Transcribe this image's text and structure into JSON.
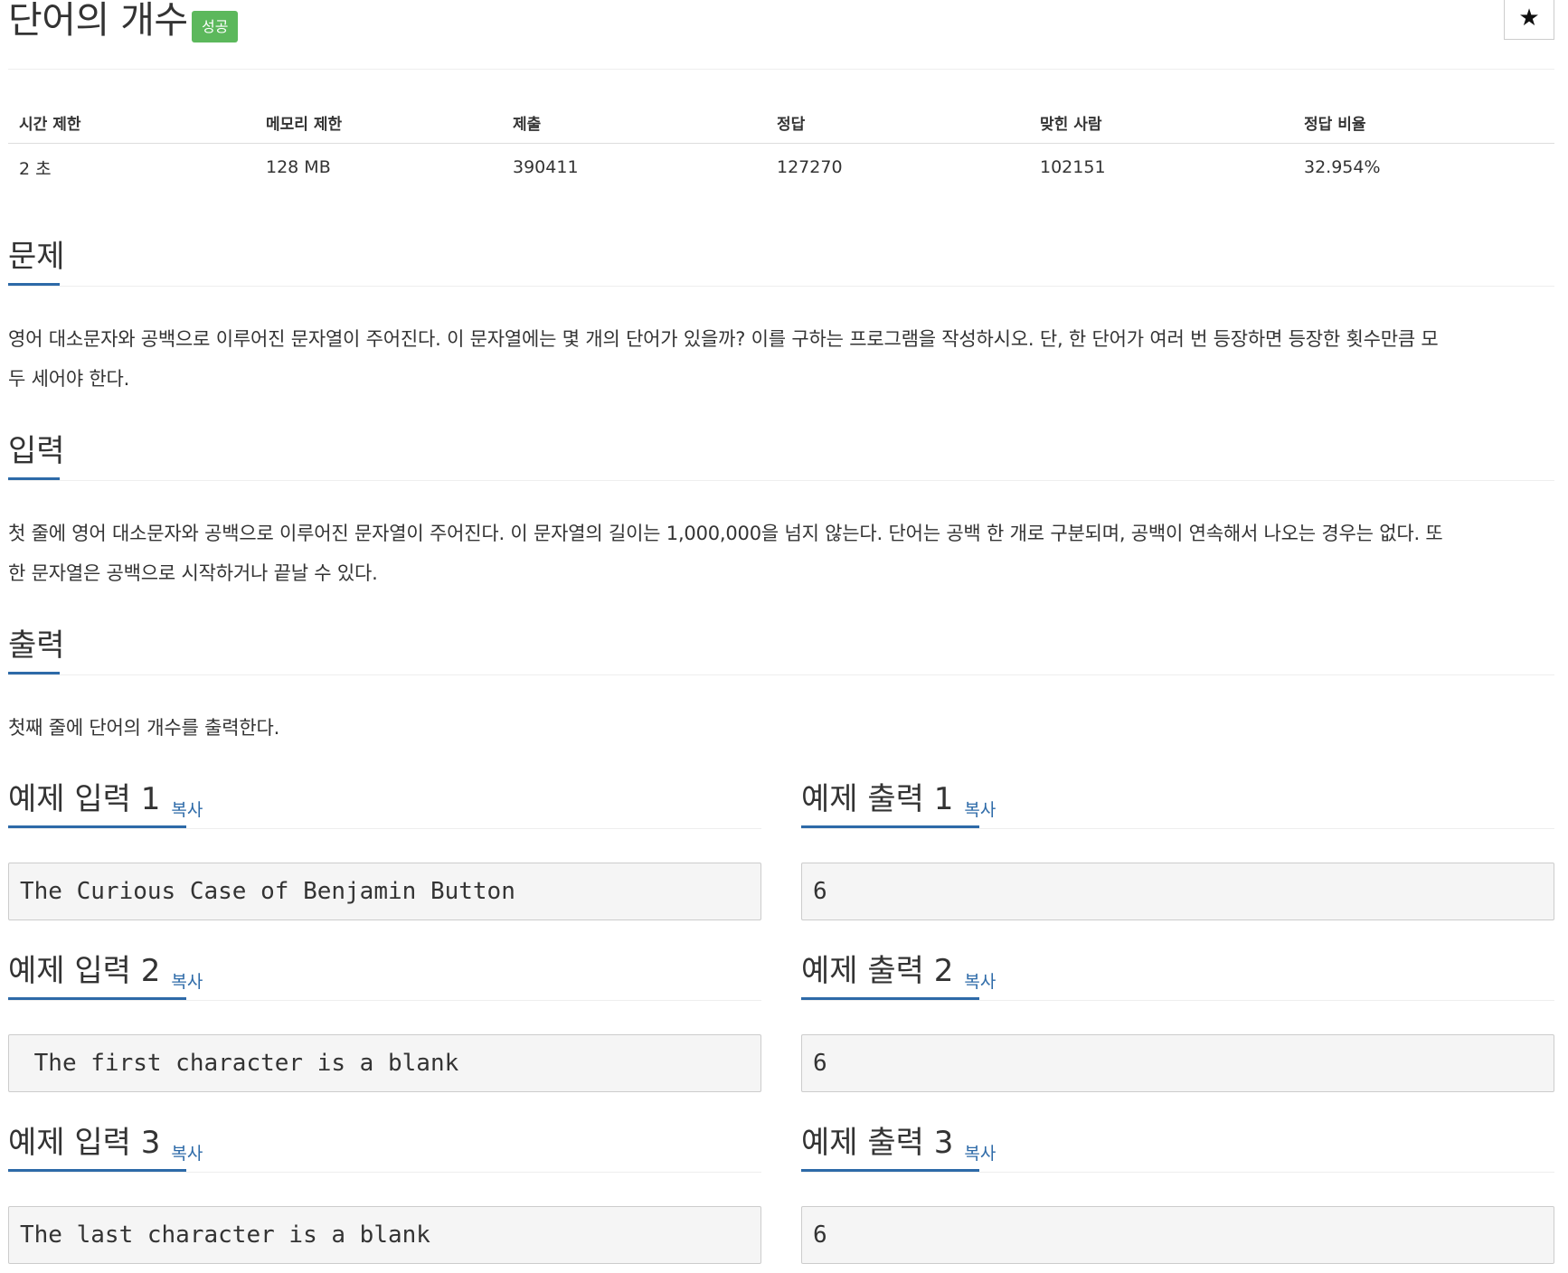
{
  "problem": {
    "title": "단어의 개수",
    "badge": "성공",
    "star": "★"
  },
  "info_table": {
    "headers": [
      "시간 제한",
      "메모리 제한",
      "제출",
      "정답",
      "맞힌 사람",
      "정답 비율"
    ],
    "values": [
      "2 초",
      "128 MB",
      "390411",
      "127270",
      "102151",
      "32.954%"
    ]
  },
  "sections": {
    "description": {
      "title": "문제",
      "lines": [
        "영어 대소문자와 공백으로 이루어진 문자열이 주어진다. 이 문자열에는 몇 개의 단어가 있을까? 이를 구하는 프로그램을 작성하시오. 단, 한 단어가 여러 번 등장하면 등장한 횟수만큼 모",
        "두 세어야 한다."
      ]
    },
    "input": {
      "title": "입력",
      "lines": [
        "첫 줄에 영어 대소문자와 공백으로 이루어진 문자열이 주어진다. 이 문자열의 길이는 1,000,000을 넘지 않는다. 단어는 공백 한 개로 구분되며, 공백이 연속해서 나오는 경우는 없다. 또",
        "한 문자열은 공백으로 시작하거나 끝날 수 있다."
      ]
    },
    "output": {
      "title": "출력",
      "lines": [
        "첫째 줄에 단어의 개수를 출력한다."
      ]
    }
  },
  "samples": {
    "copy_label": "복사",
    "items": [
      {
        "input_title": "예제 입력 1",
        "input": "The Curious Case of Benjamin Button",
        "output_title": "예제 출력 1",
        "output": "6"
      },
      {
        "input_title": "예제 입력 2",
        "input": " The first character is a blank",
        "output_title": "예제 출력 2",
        "output": "6"
      },
      {
        "input_title": "예제 입력 3",
        "input": "The last character is a blank",
        "output_title": "예제 출력 3",
        "output": "6"
      }
    ]
  },
  "colors": {
    "accent": "#2d6aa8",
    "badge_success": "#5cb85c"
  }
}
